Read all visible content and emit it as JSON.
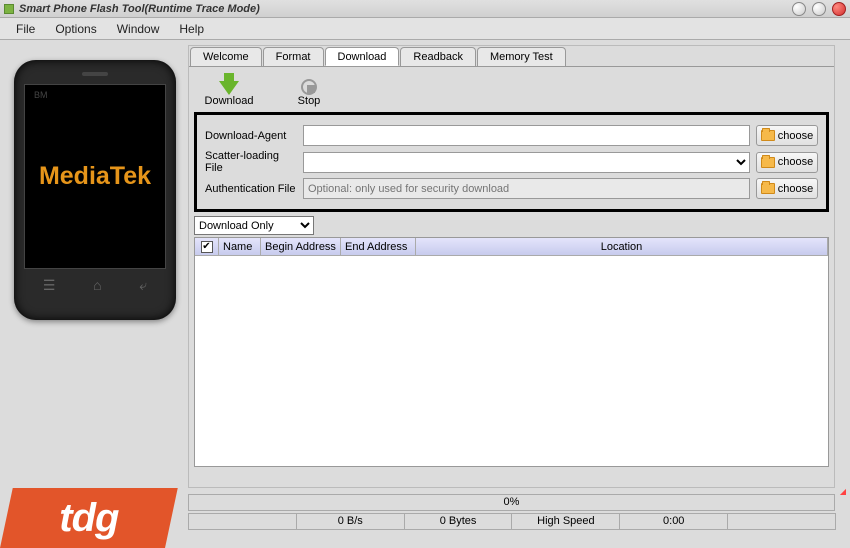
{
  "window": {
    "title": "Smart Phone Flash Tool(Runtime Trace Mode)"
  },
  "menu": {
    "file": "File",
    "options": "Options",
    "window": "Window",
    "help": "Help"
  },
  "tabs": {
    "welcome": "Welcome",
    "format": "Format",
    "download": "Download",
    "readback": "Readback",
    "memory_test": "Memory Test"
  },
  "toolbar": {
    "download": "Download",
    "stop": "Stop"
  },
  "file_fields": {
    "download_agent_label": "Download-Agent",
    "download_agent_value": "",
    "scatter_label": "Scatter-loading File",
    "scatter_value": "",
    "auth_label": "Authentication File",
    "auth_placeholder": "Optional: only used for security download",
    "choose": "choose"
  },
  "mode": {
    "selected": "Download Only"
  },
  "table": {
    "headers": {
      "name": "Name",
      "begin": "Begin Address",
      "end": "End Address",
      "location": "Location"
    }
  },
  "status": {
    "progress": "0%",
    "speed": "0 B/s",
    "bytes": "0 Bytes",
    "mode": "High Speed",
    "time": "0:00",
    "empty1": "",
    "empty2": ""
  },
  "phone": {
    "brand": "MediaTek",
    "bm": "BM"
  },
  "watermark": "tdg"
}
